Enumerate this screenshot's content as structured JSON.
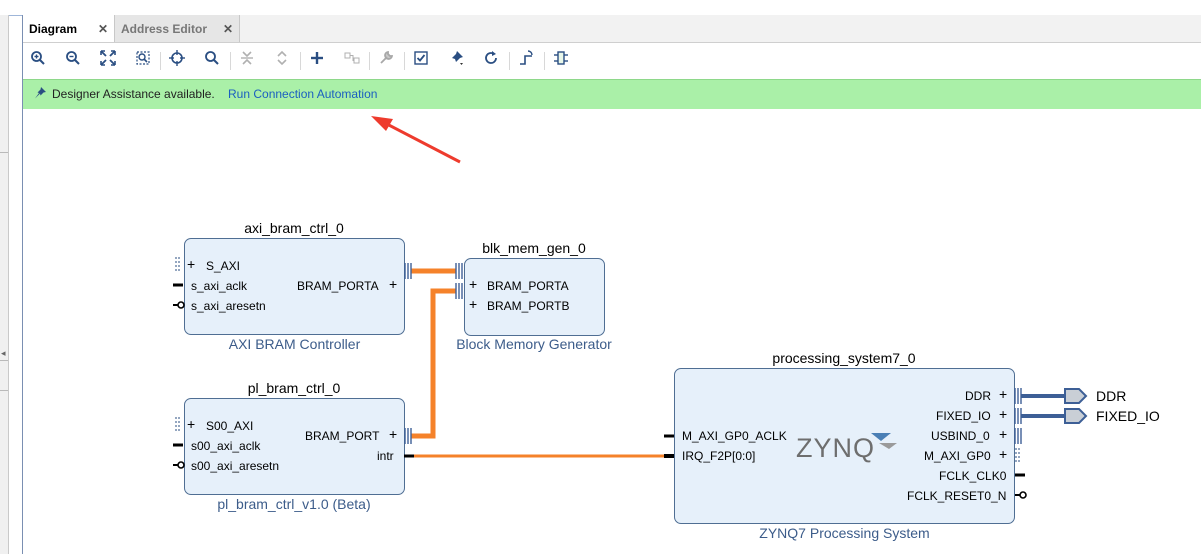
{
  "tabs": [
    {
      "label": "Diagram",
      "active": true
    },
    {
      "label": "Address Editor",
      "active": false
    }
  ],
  "toolbar": {
    "icons": [
      "zoom-in-icon",
      "zoom-out-icon",
      "zoom-fit-icon",
      "zoom-area-icon",
      "center-icon",
      "search-icon",
      "collapse-all-icon",
      "expand-all-icon",
      "add-ip-icon",
      "make-connection-icon",
      "properties-icon",
      "validate-icon",
      "pin-icon",
      "refresh-icon",
      "regenerate-layout-icon",
      "optimize-routing-icon"
    ]
  },
  "assist": {
    "message": "Designer Assistance available.",
    "link": "Run Connection Automation"
  },
  "blocks": {
    "axi_bram": {
      "name": "axi_bram_ctrl_0",
      "type": "AXI BRAM Controller",
      "ports_left": [
        "S_AXI",
        "s_axi_aclk",
        "s_axi_aresetn"
      ],
      "ports_right": [
        "BRAM_PORTA"
      ]
    },
    "blk_mem": {
      "name": "blk_mem_gen_0",
      "type": "Block Memory Generator",
      "ports_left": [
        "BRAM_PORTA",
        "BRAM_PORTB"
      ]
    },
    "pl_bram": {
      "name": "pl_bram_ctrl_0",
      "type": "pl_bram_ctrl_v1.0 (Beta)",
      "ports_left": [
        "S00_AXI",
        "s00_axi_aclk",
        "s00_axi_aresetn"
      ],
      "ports_right": [
        "BRAM_PORT",
        "intr"
      ]
    },
    "ps7": {
      "name": "processing_system7_0",
      "type": "ZYNQ7 Processing System",
      "logo": "ZYNQ",
      "ports_left": [
        "M_AXI_GP0_ACLK",
        "IRQ_F2P[0:0]"
      ],
      "ports_right": [
        "DDR",
        "FIXED_IO",
        "USBIND_0",
        "M_AXI_GP0",
        "FCLK_CLK0",
        "FCLK_RESET0_N"
      ]
    }
  },
  "external_ports": [
    "DDR",
    "FIXED_IO"
  ],
  "colors": {
    "bram_net": "#f5822a",
    "intr_net": "#f5822a",
    "ext_net": "#3d5f96",
    "assist_bg": "#aaf0a8",
    "arrow": "#ee3b2d"
  }
}
